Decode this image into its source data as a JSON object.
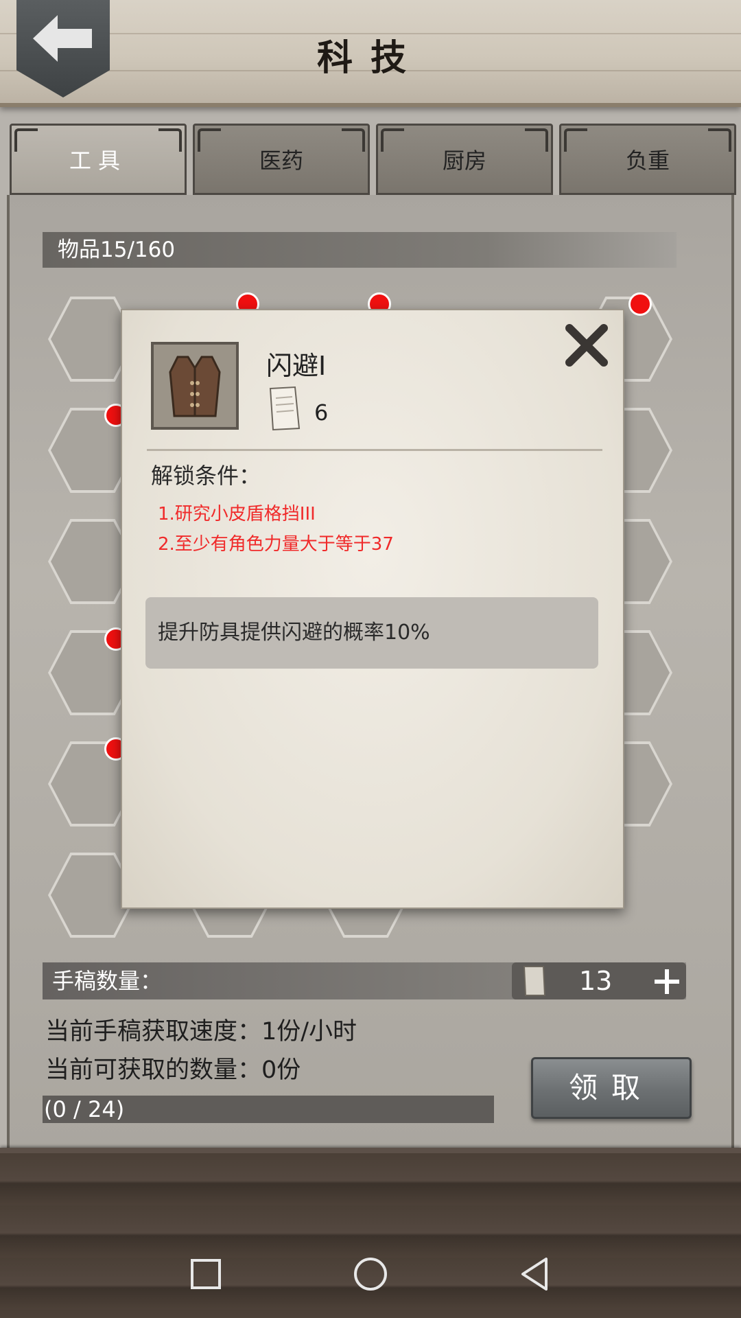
{
  "header": {
    "title": "科技"
  },
  "tabs": [
    {
      "label": "工具",
      "active": true
    },
    {
      "label": "医药",
      "active": false
    },
    {
      "label": "厨房",
      "active": false
    },
    {
      "label": "负重",
      "active": false
    }
  ],
  "items_bar": {
    "label": "物品15/160"
  },
  "dialog": {
    "name": "闪避I",
    "manuscript_cost": "6",
    "unlock_title": "解锁条件：",
    "conditions": [
      "1.研究小皮盾格挡III",
      "2.至少有角色力量大于等于37"
    ],
    "description": "提升防具提供闪避的概率10%"
  },
  "manuscript": {
    "label": "手稿数量：",
    "count": "13",
    "speed_text": "当前手稿获取速度：1份/小时",
    "available_text": "当前可获取的数量：0份",
    "progress_text": "(0 / 24)",
    "progress_value": 0,
    "progress_max": 24
  },
  "claim_button": {
    "label": "领取"
  },
  "colors": {
    "alert_dot": "#f01010",
    "condition_text": "#f02a2a"
  },
  "nav": {
    "icons": [
      "recent-apps-icon",
      "home-icon",
      "back-icon"
    ]
  }
}
